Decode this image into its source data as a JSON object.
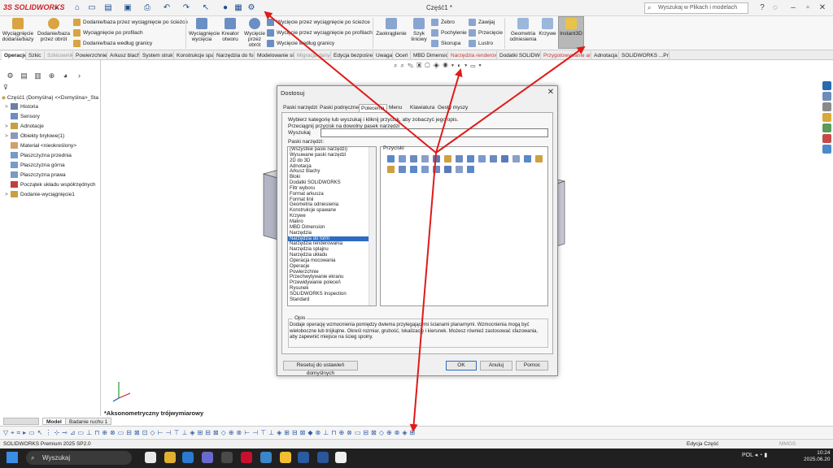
{
  "app": {
    "logo": "SOLIDWORKS",
    "logo_prefix": "3S",
    "doc_title": "Część1 *"
  },
  "search": {
    "placeholder": "Wyszukaj w Plikach i modelach"
  },
  "ribbon": {
    "big": [
      {
        "label": "Wyciągnięcie dodania/bazy"
      },
      {
        "label": "Dodanie/baza przez obrót"
      },
      {
        "label": "Wyciągnięcie wycięcia"
      },
      {
        "label": "Kreator otworu"
      },
      {
        "label": "Wycięcie przez obrót"
      },
      {
        "label": "Zaokrąglenie"
      },
      {
        "label": "Szyk liniowy"
      },
      {
        "label": "Geometria odniesienia"
      },
      {
        "label": "Krzywe"
      },
      {
        "label": "Instant3D"
      }
    ],
    "small": [
      {
        "label": "Dodanie/baza przez wyciągnięcie po ścieżce"
      },
      {
        "label": "Wyciągnięcie po profilach"
      },
      {
        "label": "Dodanie/baza według granicy"
      },
      {
        "label": "Wycięcie przez wyciągnięcie po ścieżce"
      },
      {
        "label": "Wycięcie przez wyciągnięcie po profilach"
      },
      {
        "label": "Wycięcie według granicy"
      },
      {
        "label": "Żebro"
      },
      {
        "label": "Pochylenie"
      },
      {
        "label": "Skorupa"
      },
      {
        "label": "Zawijaj"
      },
      {
        "label": "Przecięcie"
      },
      {
        "label": "Lustro"
      }
    ]
  },
  "tabs": [
    {
      "label": "Operacje",
      "state": "active"
    },
    {
      "label": "Szkic"
    },
    {
      "label": "Szkicownik",
      "state": "dim"
    },
    {
      "label": "Powierzchnie"
    },
    {
      "label": "Arkusz blachy"
    },
    {
      "label": "System struktur"
    },
    {
      "label": "Konstrukcje spawane"
    },
    {
      "label": "Narzędzia do form"
    },
    {
      "label": "Modelowanie siatki"
    },
    {
      "label": "Migracja danych",
      "state": "dim"
    },
    {
      "label": "Edycja bezpośrednia"
    },
    {
      "label": "Uwaga"
    },
    {
      "label": "Oceń"
    },
    {
      "label": "MBD Dimension"
    },
    {
      "label": "Narzędzia renderowania",
      "state": "red"
    },
    {
      "label": "Dodatki SOLIDWORKS"
    },
    {
      "label": "Przygotowywanie analizy",
      "state": "red"
    },
    {
      "label": "Adnotacja"
    },
    {
      "label": "SOLIDWORKS ...Prz...SOL..."
    }
  ],
  "tree": {
    "root": "Część1 (Domyślna) <<Domyślna>_Sta",
    "items": [
      {
        "label": "Historia",
        "toggle": ">",
        "color": "#6a7fa8"
      },
      {
        "label": "Sensory",
        "toggle": "",
        "color": "#6e8cc0"
      },
      {
        "label": "Adnotacje",
        "toggle": ">",
        "color": "#c8a040"
      },
      {
        "label": "Obiekty bryłowe(1)",
        "toggle": ">",
        "color": "#8a9ab8"
      },
      {
        "label": "Materiał <nieokreślony>",
        "toggle": "",
        "color": "#d0a070"
      },
      {
        "label": "Płaszczyzna przednia",
        "toggle": "",
        "color": "#7a9ac8"
      },
      {
        "label": "Płaszczyzna górna",
        "toggle": "",
        "color": "#7a9ac8"
      },
      {
        "label": "Płaszczyzna prawa",
        "toggle": "",
        "color": "#7a9ac8"
      },
      {
        "label": "Początek układu współrzędnych",
        "toggle": "",
        "color": "#c04040"
      },
      {
        "label": "Dodanie-wyciągnięcie1",
        "toggle": ">",
        "color": "#c8a040"
      }
    ]
  },
  "view": {
    "label": "*Aksonometryczny trójwymiarowy"
  },
  "bottom_tabs": [
    "Model",
    "Badanie ruchu 1"
  ],
  "status": {
    "left": "SOLIDWORKS Premium 2025 SP2.0",
    "middle": "Edycja Część",
    "right": "MMGS"
  },
  "taskbar": {
    "search": "Wyszukaj",
    "lang": "POL",
    "time": "10:24",
    "date": "2025.06.20"
  },
  "dialog": {
    "title": "Dostosuj",
    "tabs": [
      "Paski narzędzi",
      "Paski podręczne",
      "Polecenia",
      "Menu",
      "Klawiatura",
      "Gesty myszy"
    ],
    "active_tab": 2,
    "instruction_1": "Wybierz kategorię lub wyszukaj i kliknij przycisk, aby zobaczyć jego opis.",
    "instruction_2": "Przeciągnij przycisk na dowolny pasek narzędzi",
    "search_label": "Wyszukaj",
    "search_value": "",
    "list_label": "Paski narzędzi:",
    "buttons_label": "Przyciski",
    "list": [
      "(Wszystkie paski narzędzi)",
      "Wysuwane paski narzędzi",
      "2D do 3D",
      "Adnotacja",
      "Arkusz blachy",
      "Bloki",
      "Dodatki SOLIDWORKS",
      "Filtr wyboru",
      "Format arkusza",
      "Format linii",
      "Geometria odniesienia",
      "Konstrukcje spawane",
      "Krzywe",
      "Makro",
      "MBD Dimension",
      "Narzędzia",
      "Narzędzia do form",
      "Narzędzia renderowania",
      "Narzędzia splajnu",
      "Narzędzia układu",
      "Operacja mocowania",
      "Operacje",
      "Powierzchnie",
      "Przechwytywanie ekranu",
      "Przewidywanie poleceń",
      "Rysunek",
      "SOLIDWORKS Inspection",
      "Standard"
    ],
    "selected_index": 16,
    "opis_label": "Opis",
    "opis_text": "Dodaje operację wzmocnienia pomiędzy dwiema przylegającymi ścianami planarnymi. Wzmocnienia mogą być wieloboczne lub trójkątne. Określ rozmiar, grubość, lokalizację i kierunek. Możesz również zastosować sfazowania, aby zapewnić miejsce na ścieg spoiny.",
    "reset_label": "Resetuj do ustawień domyślnych",
    "ok_label": "OK",
    "cancel_label": "Anuluj",
    "help_label": "Pomoc"
  },
  "colors": {
    "arrow": "#e01a1a",
    "selection": "#2d6cc0",
    "instant3d_bg": "#b8b8b8"
  }
}
